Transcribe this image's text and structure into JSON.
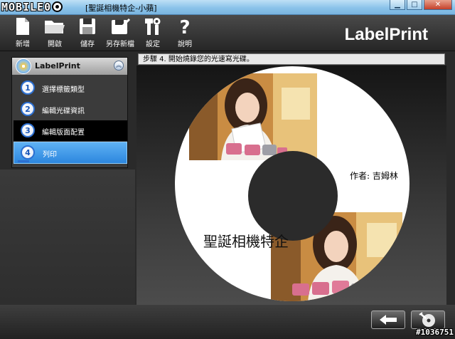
{
  "window": {
    "watermark_logo_text": "MOBILE01",
    "title": "[聖誕相機特企-小蘋]",
    "controls": [
      "minimize-icon",
      "maximize-icon",
      "close-icon"
    ]
  },
  "toolbar": {
    "items": [
      {
        "label": "新增",
        "icon": "new-file-icon"
      },
      {
        "label": "開啟",
        "icon": "open-folder-icon"
      },
      {
        "label": "儲存",
        "icon": "save-disk-icon"
      },
      {
        "label": "另存新檔",
        "icon": "save-as-icon"
      },
      {
        "label": "設定",
        "icon": "tools-icon"
      },
      {
        "label": "說明",
        "icon": "help-icon"
      }
    ],
    "brand": "LabelPrint"
  },
  "step_bar": {
    "text": "步驟 4. 開始燒錄您的光速寫光碟。"
  },
  "left_panel": {
    "title": "LabelPrint",
    "steps": [
      {
        "num": "1",
        "label": "選擇標籤類型"
      },
      {
        "num": "2",
        "label": "編輯光碟資訊"
      },
      {
        "num": "3",
        "label": "編輯版面配置"
      },
      {
        "num": "4",
        "label": "列印"
      }
    ],
    "active_step": 4
  },
  "disc": {
    "author": "作者: 吉姆林",
    "title": "聖誕相機特企"
  },
  "bottom": {
    "back_icon": "back-arrow-icon",
    "burn_icon": "disc-burn-icon",
    "image_id": "#1036751"
  },
  "colors": {
    "title_bar": "#8bc3ea",
    "active_step": "#3a93e6",
    "toolbar_bg": "#333333"
  }
}
